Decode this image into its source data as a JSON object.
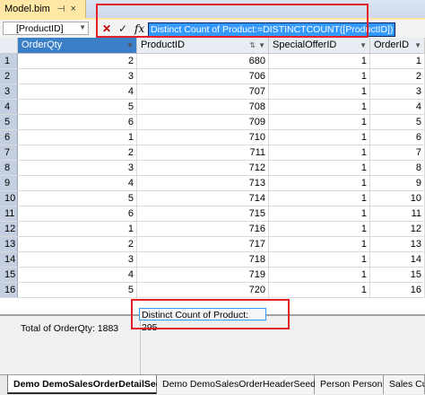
{
  "document_tab": {
    "title": "Model.bim",
    "pin_icon": "pin-icon",
    "close_icon": "close-icon",
    "close_glyph": "×",
    "pin_glyph": "⊣"
  },
  "formula_bar": {
    "name_box": "[ProductID]",
    "cancel_glyph": "✕",
    "commit_glyph": "✓",
    "fx_glyph": "fx",
    "formula": "Distinct Count of Product:=DISTINCTCOUNT([ProductID])"
  },
  "columns": [
    {
      "label": "OrderQty",
      "selected": true
    },
    {
      "label": "ProductID",
      "selected": false
    },
    {
      "label": "SpecialOfferID",
      "selected": false
    },
    {
      "label": "OrderID",
      "selected": false
    }
  ],
  "rows": [
    {
      "n": "1",
      "qty": "2",
      "product": "680",
      "offer": "1",
      "order": "1"
    },
    {
      "n": "2",
      "qty": "3",
      "product": "706",
      "offer": "1",
      "order": "2"
    },
    {
      "n": "3",
      "qty": "4",
      "product": "707",
      "offer": "1",
      "order": "3"
    },
    {
      "n": "4",
      "qty": "5",
      "product": "708",
      "offer": "1",
      "order": "4"
    },
    {
      "n": "5",
      "qty": "6",
      "product": "709",
      "offer": "1",
      "order": "5"
    },
    {
      "n": "6",
      "qty": "1",
      "product": "710",
      "offer": "1",
      "order": "6"
    },
    {
      "n": "7",
      "qty": "2",
      "product": "711",
      "offer": "1",
      "order": "7"
    },
    {
      "n": "8",
      "qty": "3",
      "product": "712",
      "offer": "1",
      "order": "8"
    },
    {
      "n": "9",
      "qty": "4",
      "product": "713",
      "offer": "1",
      "order": "9"
    },
    {
      "n": "10",
      "qty": "5",
      "product": "714",
      "offer": "1",
      "order": "10"
    },
    {
      "n": "11",
      "qty": "6",
      "product": "715",
      "offer": "1",
      "order": "11"
    },
    {
      "n": "12",
      "qty": "1",
      "product": "716",
      "offer": "1",
      "order": "12"
    },
    {
      "n": "13",
      "qty": "2",
      "product": "717",
      "offer": "1",
      "order": "13"
    },
    {
      "n": "14",
      "qty": "3",
      "product": "718",
      "offer": "1",
      "order": "14"
    },
    {
      "n": "15",
      "qty": "4",
      "product": "719",
      "offer": "1",
      "order": "15"
    },
    {
      "n": "16",
      "qty": "5",
      "product": "720",
      "offer": "1",
      "order": "16"
    }
  ],
  "measures": {
    "total": "Total of OrderQty: 1883",
    "distinct": "Distinct Count of Product: 295"
  },
  "sheet_tabs": [
    {
      "label": "Demo DemoSalesOrderDetailSeed",
      "active": true
    },
    {
      "label": "Demo DemoSalesOrderHeaderSeed",
      "active": false
    },
    {
      "label": "Person Person",
      "active": false
    },
    {
      "label": "Sales Cust",
      "active": false
    }
  ],
  "colors": {
    "highlight": "#3399ff",
    "annotation": "#e2202a",
    "doc_tab": "#ffe8a6"
  }
}
